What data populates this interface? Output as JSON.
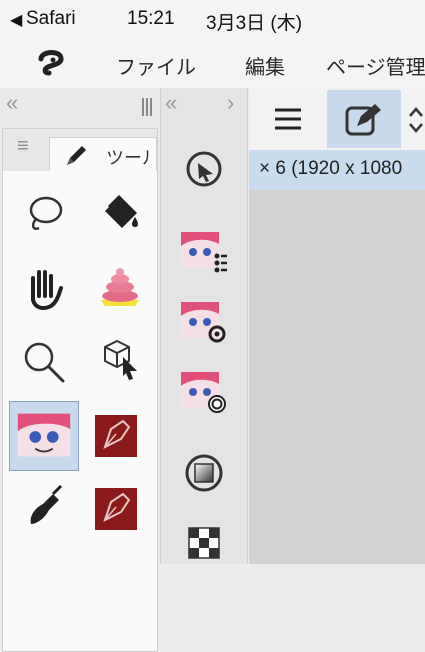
{
  "status_bar": {
    "back_glyph": "◀",
    "app": "Safari",
    "time": "15:21",
    "date": "3月3日 (木)"
  },
  "menu": {
    "logo_icon": "clip-studio-logo-icon",
    "items": [
      "ファイル",
      "編集",
      "ページ管理"
    ]
  },
  "tool_panel": {
    "collapse_glyph": "«",
    "tab_menu_glyph": "≡",
    "tab_label": "ツール",
    "tools": [
      {
        "name": "lasso-tool",
        "icon": "lasso-icon"
      },
      {
        "name": "fill-tool",
        "icon": "paint-bucket-icon"
      },
      {
        "name": "hand-tool",
        "icon": "hand-icon"
      },
      {
        "name": "poop-tool",
        "icon": "swirl-icon"
      },
      {
        "name": "zoom-tool",
        "icon": "magnifier-icon"
      },
      {
        "name": "object-tool",
        "icon": "cube-cursor-icon"
      },
      {
        "name": "character-tool",
        "icon": "character-avatar-icon",
        "selected": true
      },
      {
        "name": "pen-tool",
        "icon": "pen-nib-icon"
      },
      {
        "name": "brush-tool",
        "icon": "brush-icon"
      },
      {
        "name": "pen-tool-2",
        "icon": "pen-nib-icon"
      }
    ]
  },
  "mid_panel": {
    "collapse_glyph": "«",
    "expand_glyph": "›",
    "items": [
      {
        "name": "navigator-icon"
      },
      {
        "name": "character-list-icon"
      },
      {
        "name": "character-settings-icon"
      },
      {
        "name": "character-layer-icon"
      },
      {
        "name": "gradient-icon"
      },
      {
        "name": "grid-icon"
      }
    ]
  },
  "canvas": {
    "tab_title": "× 6 (1920 x 1080"
  },
  "colors": {
    "accent": "#c8d9ee",
    "selected_border": "#8aa2bf",
    "pen_red": "#8b1a1a"
  }
}
